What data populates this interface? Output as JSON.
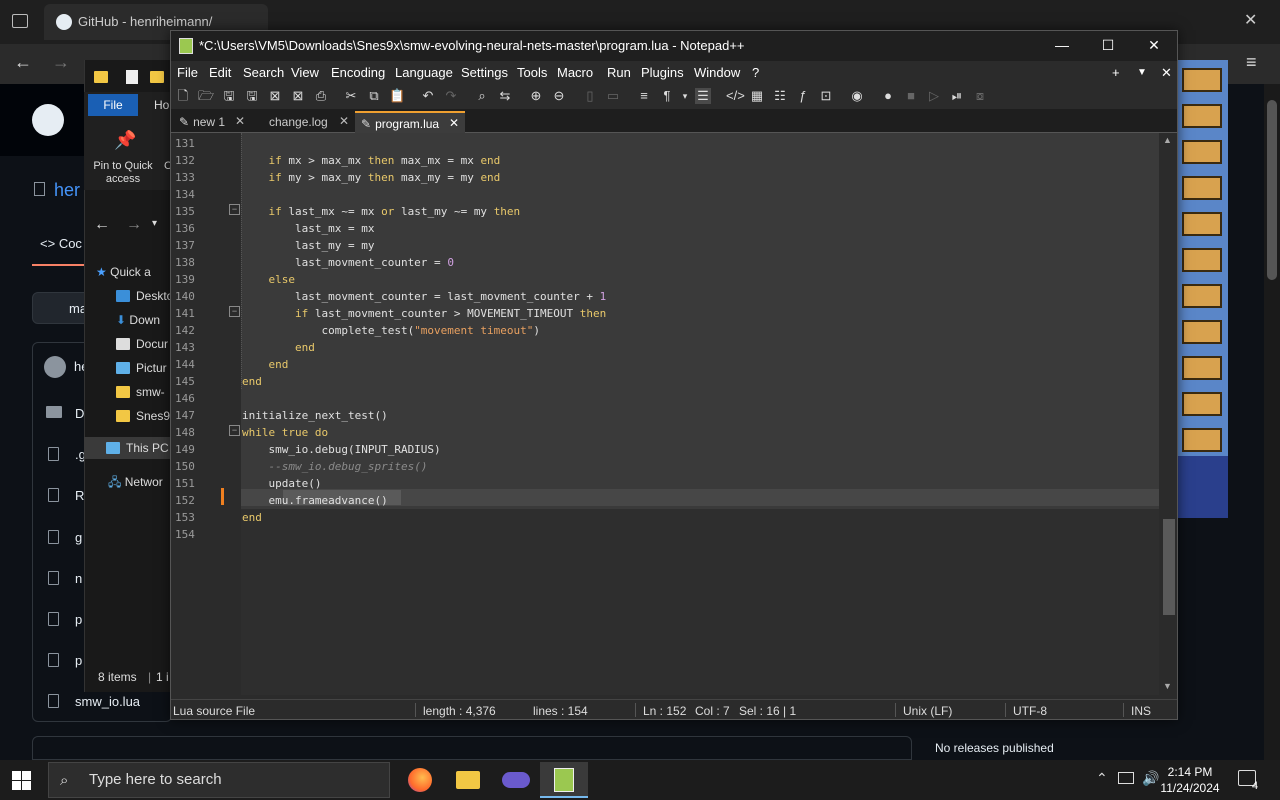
{
  "browser": {
    "tab_title": "GitHub - henriheimann/",
    "repo_prefix": "her",
    "code_tab": "Coc",
    "branch_prefix": "ma",
    "owner_prefix": "he",
    "files": [
      ".g",
      "R",
      "g",
      "n",
      "p",
      "p"
    ],
    "file_prefix_d": "D",
    "smw_io": "smw_io.lua",
    "no_releases": "No releases published"
  },
  "explorer": {
    "file_tab": "File",
    "home_tab": "Ho",
    "pin_label": "Pin to Quick access",
    "c_label": "C",
    "nav": [
      "Quick a",
      "Deskto",
      "Down",
      "Docur",
      "Pictur",
      "smw-",
      "Snes9x",
      "This PC",
      "Networ"
    ],
    "status_items": "8 items",
    "status_sep": "1 i"
  },
  "notepad": {
    "title": "*C:\\Users\\VM5\\Downloads\\Snes9x\\smw-evolving-neural-nets-master\\program.lua - Notepad++",
    "menu": [
      "File",
      "Edit",
      "Search",
      "View",
      "Encoding",
      "Language",
      "Settings",
      "Tools",
      "Macro",
      "Run",
      "Plugins",
      "Window",
      "?"
    ],
    "menu_right": [
      "+",
      "▼",
      "✕"
    ],
    "tabs": [
      {
        "label": "new 1",
        "active": false
      },
      {
        "label": "change.log",
        "active": false
      },
      {
        "label": "program.lua",
        "active": true
      }
    ],
    "line_numbers": [
      "131",
      "132",
      "133",
      "134",
      "135",
      "136",
      "137",
      "138",
      "139",
      "140",
      "141",
      "142",
      "143",
      "144",
      "145",
      "146",
      "147",
      "148",
      "149",
      "150",
      "151",
      "152",
      "153",
      "154"
    ],
    "status": {
      "file_type": "Lua source File",
      "length": "length : 4,376",
      "lines": "lines : 154",
      "ln": "Ln : 152",
      "col": "Col : 7",
      "sel": "Sel : 16 | 1",
      "eol": "Unix (LF)",
      "encoding": "UTF-8",
      "mode": "INS"
    }
  },
  "taskbar": {
    "search_placeholder": "Type here to search",
    "time": "2:14 PM",
    "date": "11/24/2024",
    "notif_count": "4"
  },
  "colors": {
    "keyword": "#e8c86a",
    "number": "#d0a0e0",
    "string": "#e8a060",
    "comment": "#8a8a8a",
    "accent": "#f0a030"
  }
}
